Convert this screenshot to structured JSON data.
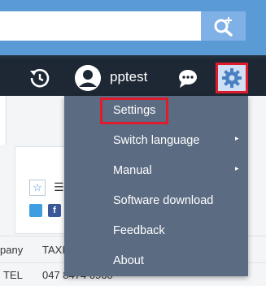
{
  "search": {
    "placeholder": "",
    "button_icon": "search-plus-icon"
  },
  "toolbar": {
    "history_icon": "history-icon",
    "avatar_icon": "user-avatar-icon",
    "username": "pptest",
    "chat_icon": "chat-bubble-icon",
    "settings_icon": "gear-icon"
  },
  "background": {
    "row1_label": "pany",
    "row1_value": "TAXI",
    "row2_label": "TEL",
    "row2_value": "047 8474 0960",
    "fb_letter": "f"
  },
  "menu": {
    "items": [
      {
        "label": "Settings",
        "has_submenu": false,
        "highlighted": true
      },
      {
        "label": "Switch language",
        "has_submenu": true
      },
      {
        "label": "Manual",
        "has_submenu": true
      },
      {
        "label": "Software download",
        "has_submenu": false
      },
      {
        "label": "Feedback",
        "has_submenu": false
      },
      {
        "label": "About",
        "has_submenu": false
      }
    ],
    "submenu_arrow": "▸"
  },
  "colors": {
    "search_strip": "#5b9bd5",
    "toolbar": "#1e2835",
    "menu_bg": "#5b6b82",
    "highlight_border": "#e01b2b"
  }
}
